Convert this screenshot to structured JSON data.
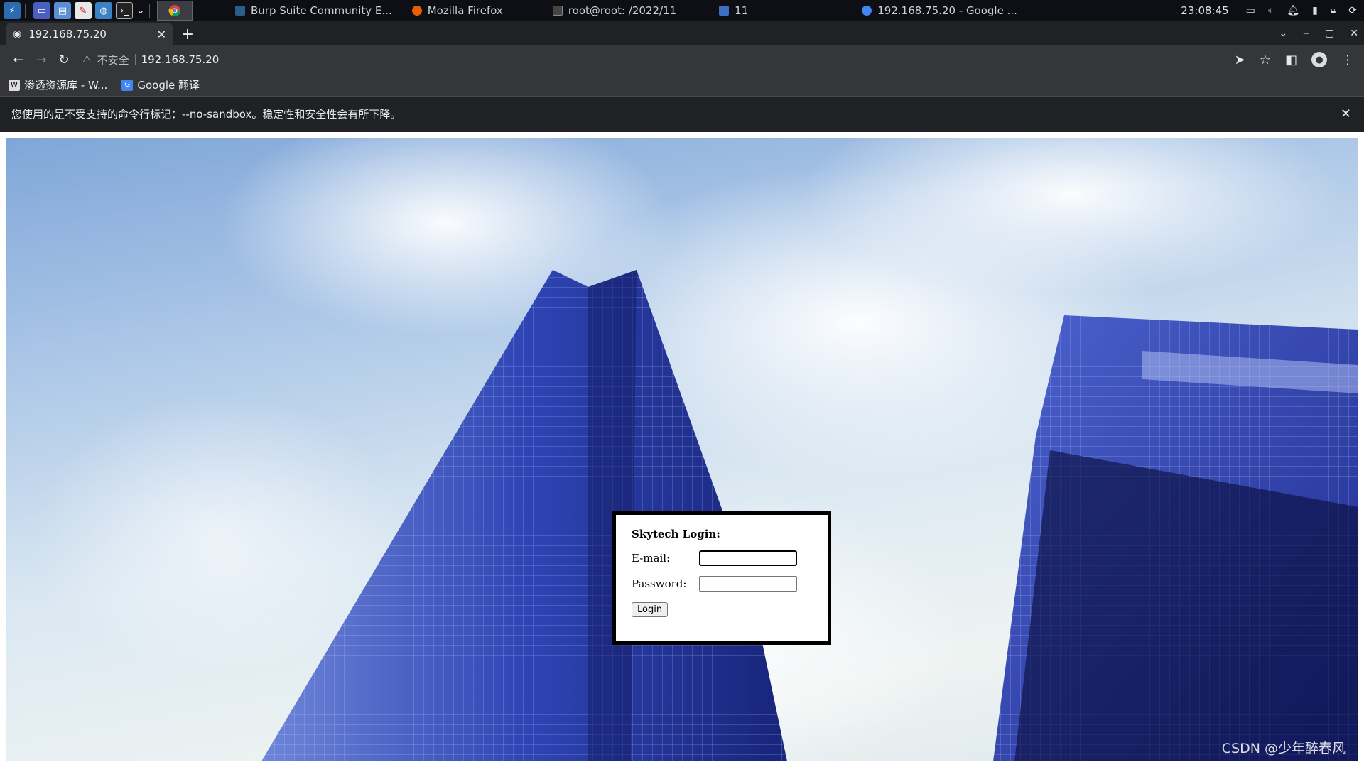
{
  "taskbar": {
    "windows": [
      {
        "label": "Burp Suite Community E...",
        "icon": "burp-icon",
        "color": "#2a5d8a"
      },
      {
        "label": "Mozilla Firefox",
        "icon": "firefox-icon",
        "color": "#e66000"
      },
      {
        "label": "root@root: /2022/11",
        "icon": "terminal-icon",
        "color": "#444444"
      },
      {
        "label": "11",
        "icon": "folder-icon",
        "color": "#3b6fc4"
      },
      {
        "label": "192.168.75.20 - Google ...",
        "icon": "chrome-icon",
        "color": "#4285f4"
      }
    ],
    "clock": "23:08:45"
  },
  "browser": {
    "tab_title": "192.168.75.20",
    "insecure_label": "不安全",
    "url": "192.168.75.20",
    "bookmarks": [
      {
        "label": "渗透资源库 - W..."
      },
      {
        "label": "Google 翻译"
      }
    ],
    "infobar_text": "您使用的是不受支持的命令行标记：--no-sandbox。稳定性和安全性会有所下降。"
  },
  "login": {
    "title": "Skytech Login:",
    "email_label": "E-mail:",
    "email_value": "",
    "password_label": "Password:",
    "password_value": "",
    "button_label": "Login"
  },
  "watermark": "CSDN @少年醉春风",
  "colors": {
    "sky": "#a8c4e6",
    "building": "#3045b0",
    "chrome_dark": "#202124",
    "chrome_toolbar": "#35363a"
  }
}
